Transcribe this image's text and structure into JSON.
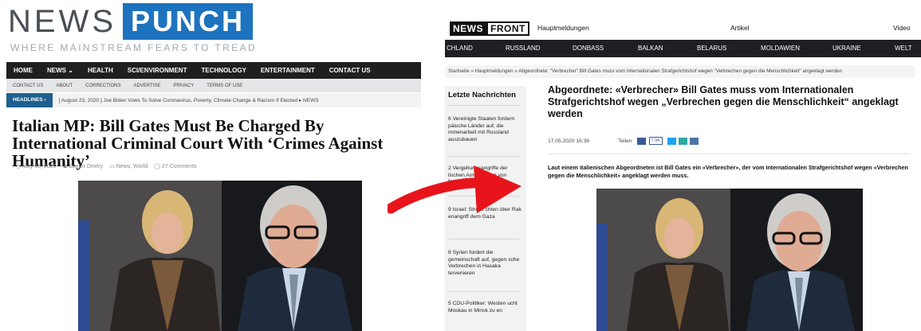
{
  "left": {
    "logo": {
      "news": "NEWS",
      "punch": "PUNCH"
    },
    "tagline": "WHERE MAINSTREAM FEARS TO TREAD",
    "nav": [
      "HOME",
      "NEWS ⌄",
      "HEALTH",
      "SCI/ENVIRONMENT",
      "TECHNOLOGY",
      "ENTERTAINMENT",
      "CONTACT US"
    ],
    "subnav": [
      "CONTACT US",
      "ABOUT",
      "CORRECTIONS",
      "ADVERTISE",
      "PRIVACY",
      "TERMS OF USE"
    ],
    "headlines_badge": "HEADLINES ›",
    "headlines_text": "[ August 23, 2020 ]  Joe Biden Vows To Solve Coronavirus, Poverty, Climate Change & Racism If Elected  ▸  NEWS",
    "article_title": "Italian MP: Bill Gates Must Be Charged By International Criminal Court With ‘Crimes Against Humanity’",
    "meta": {
      "date": "◷ May 15, 2020",
      "author": "♟ Baxter Dmitry",
      "categories": "▭ News, World",
      "comments": "◯ 27 Comments"
    }
  },
  "right": {
    "logo": {
      "news": "NEWS",
      "front": "FRONT"
    },
    "top_links": [
      "Hauptmeldungen",
      "Artikel",
      "Video"
    ],
    "regions": [
      "CHLAND",
      "RUSSLAND",
      "DONBASS",
      "BALKAN",
      "BELARUS",
      "MOLDAWIEN",
      "UKRAINE",
      "WELT"
    ],
    "breadcrumb": "Startseite  »  Hauptmeldungen  »  Abgeordnete: \"Verbrecher\" Bill Gates muss vom Internationalen Strafgerichtshof wegen \"Verbrechen gegen die Menschlichkeit\" angeklagt werden",
    "sidebar": {
      "heading": "Letzte Nachrichten",
      "items": [
        "6 Vereinigte Staaten fordern päische Länder auf, die mmenarbeit mit Russland auszubauen",
        "2 Vergeltungsangriffe der lischen Armee  n den von fortgesetzt",
        "9 Israel: Streitk  chten über Rak  enangriff dem Gaza",
        "8 Syrien fordert die gemeinschaft auf, gegen sche Verbrechen in Hasaka tervenieren",
        "5 CDU-Politiker: Westen ucht Moskau in Minsk zu en"
      ]
    },
    "article_title": "Abgeordnete: «Verbrecher» Bill Gates muss vom Internationalen Strafgerichtshof wegen „Verbrechen gegen die Menschlichkeit“ angeklagt werden",
    "date": "17.05.2020 16:36",
    "share_label": "Teilen",
    "share_count": "7.9K",
    "lead": "Laut einem italienischen Abgeordneten ist Bill Gates ein «Verbrecher», der vom Internationalen Strafgerichtshof wegen «Verbrechen gegen die Menschlichkeit» angeklagt werden muss."
  },
  "colors": {
    "punch_blue": "#1e73be",
    "nav_dark": "#1d1f21",
    "arrow_red": "#e8141b",
    "facebook_blue": "#3b5998"
  }
}
